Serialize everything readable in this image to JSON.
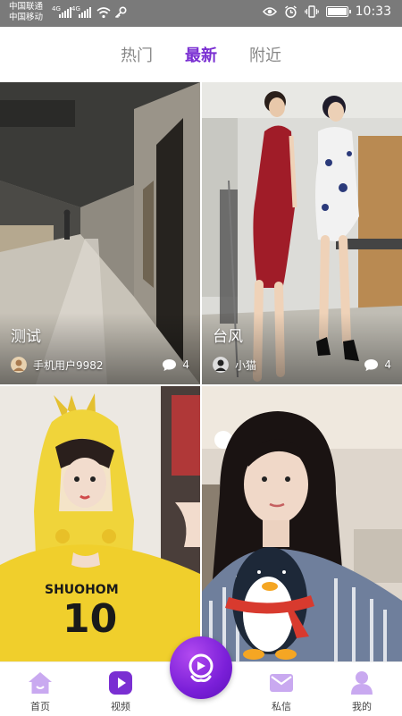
{
  "status_bar": {
    "carrier_1": "中国联通",
    "carrier_2": "中国移动",
    "net_1": "4G",
    "net_2": "4G",
    "battery_percent": 100,
    "time": "10:33",
    "icons": [
      "signal-icon",
      "wifi-icon",
      "key-icon",
      "eye-icon",
      "alarm-icon",
      "vibrate-icon",
      "battery-icon"
    ]
  },
  "tabs": [
    {
      "label": "热门",
      "active": false
    },
    {
      "label": "最新",
      "active": true
    },
    {
      "label": "附近",
      "active": false
    }
  ],
  "feed": [
    {
      "title": "测试",
      "user": "手机用户9982",
      "comments": "4"
    },
    {
      "title": "台风",
      "user": "小猫",
      "comments": "4"
    },
    {
      "title": "",
      "user": "",
      "comments": ""
    },
    {
      "title": "",
      "user": "",
      "comments": ""
    }
  ],
  "bottom_nav": {
    "items": [
      {
        "label": "首页",
        "icon": "home-icon"
      },
      {
        "label": "视频",
        "icon": "play-icon"
      },
      {
        "label": "私信",
        "icon": "mail-icon"
      },
      {
        "label": "我的",
        "icon": "profile-icon"
      }
    ],
    "center_icon": "record-icon"
  },
  "colors": {
    "accent": "#7a2fd2",
    "nav_icon": "#c9a9f0",
    "status_bar": "#7a7a7a"
  }
}
